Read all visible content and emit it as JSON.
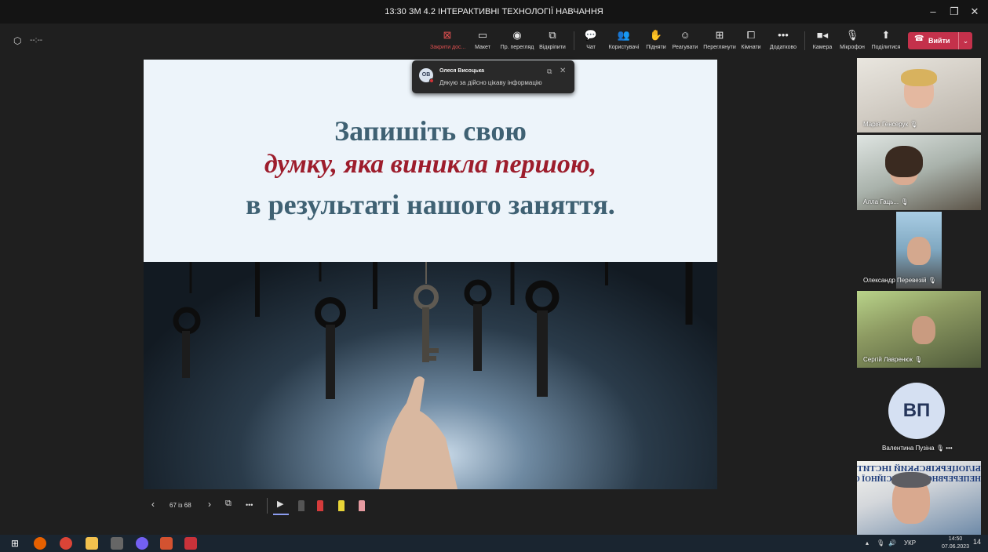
{
  "window": {
    "title": "13:30 ЗМ 4.2 ІНТЕРАКТИВНІ ТЕХНОЛОГІЇ НАВЧАННЯ",
    "minimize_icon": "minimize-icon",
    "maximize_icon": "maximize-icon",
    "close_icon": "close-icon"
  },
  "meeting": {
    "timer": "--:--"
  },
  "toolbar": {
    "stop_share": "Закрити дос...",
    "layout": "Макет",
    "presenter_view": "Пр. перегляд",
    "open": "Відкріпити",
    "chat": "Чат",
    "people": "Користувачі",
    "raise": "Підняти",
    "react": "Реагувати",
    "view": "Переглянути",
    "rooms": "Кімнати",
    "more": "Додатково",
    "camera": "Камера",
    "mic": "Мікрофон",
    "share": "Поділитися",
    "leave": "Вийти",
    "more_glyph": "•••"
  },
  "notification": {
    "initials": "ОВ",
    "name": "Олеся Висоцька",
    "message": "Дякую за дійсно цікаву інформацію"
  },
  "slide": {
    "line1": "Запишіть свою",
    "line2": "думку, яка виникла першою,",
    "line3": "в результаті нашого заняття."
  },
  "slide_controls": {
    "prev": "‹",
    "next": "›",
    "page": "67 із 68",
    "more": "•••"
  },
  "participants": [
    {
      "name": "Марія Генсерук"
    },
    {
      "name": "Алла Гаць..."
    },
    {
      "name": "Олександр Перевезій"
    },
    {
      "name": "Сергій Лавренюк"
    },
    {
      "name": "Валентина Пузіна",
      "initials": "ВП"
    },
    {
      "name": ""
    }
  ],
  "participant_extra": {
    "mic_glyph": "🎙",
    "more_glyph": "•••"
  },
  "video_banner": {
    "line1": "БІЛОЦЕРКІВСЬКИЙ ІНСТИТУТ",
    "line2": "НЕПЕРЕРВНОЇ ПРОФЕСІЙНОЇ ОСВІТИ"
  },
  "taskbar": {
    "lang": "УКР",
    "time": "14:50",
    "date": "07.06.2023",
    "notif_count": "14"
  },
  "colors": {
    "leave_red": "#c4314b",
    "slide_blue": "#3f6173",
    "slide_red": "#9d1d2c"
  }
}
